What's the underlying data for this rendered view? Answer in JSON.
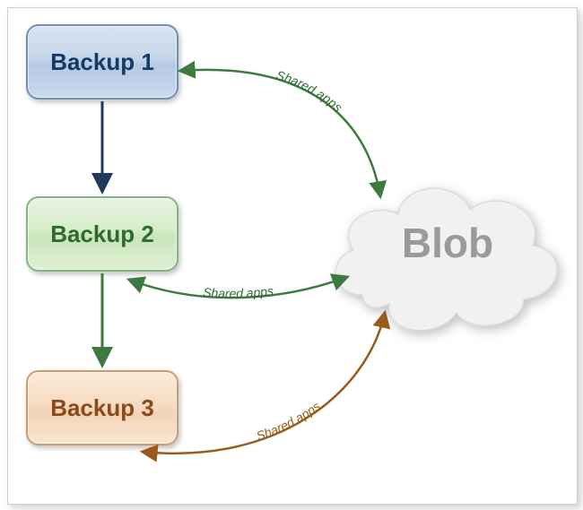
{
  "nodes": {
    "backup1": {
      "label": "Backup 1"
    },
    "backup2": {
      "label": "Backup 2"
    },
    "backup3": {
      "label": "Backup 3"
    },
    "blob": {
      "label": "Blob"
    }
  },
  "edges": {
    "b1_to_blob": {
      "label": "Shared apps"
    },
    "b2_to_blob": {
      "label": "Shared apps"
    },
    "b3_to_blob": {
      "label": "Shared apps"
    }
  },
  "colors": {
    "arrow_dark": "#1f3a5a",
    "arrow_green": "#3d7a3d",
    "arrow_brown": "#9a5a1a"
  }
}
